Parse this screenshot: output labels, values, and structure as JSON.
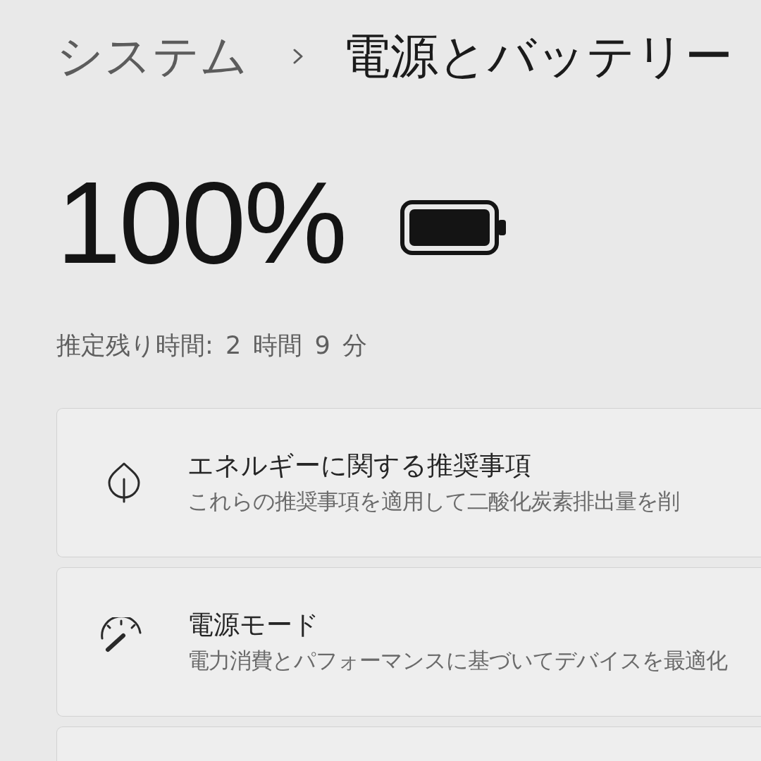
{
  "breadcrumb": {
    "parent": "システム",
    "current": "電源とバッテリー"
  },
  "battery": {
    "percent": "100%",
    "estimate": "推定残り時間: 2 時間 9 分"
  },
  "cards": [
    {
      "kind": "leaf",
      "title": "エネルギーに関する推奨事項",
      "description": "これらの推奨事項を適用して二酸化炭素排出量を削"
    },
    {
      "kind": "gauge",
      "title": "電源モード",
      "description": "電力消費とパフォーマンスに基づいてデバイスを最適化"
    }
  ]
}
